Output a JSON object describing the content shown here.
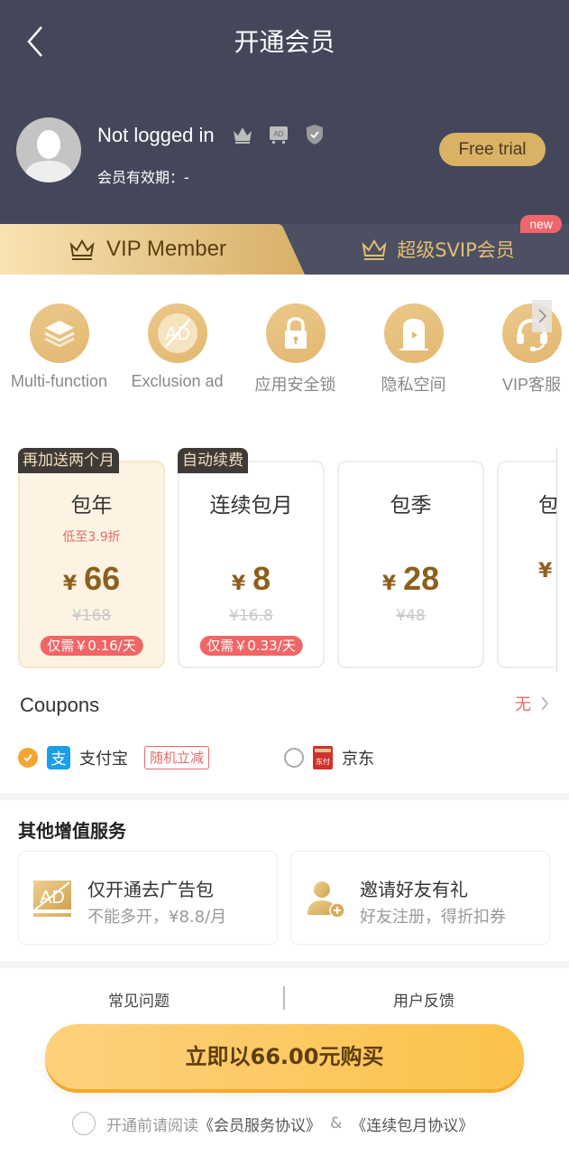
{
  "header": {
    "title": "开通会员",
    "back_icon": "chevron-left-icon"
  },
  "profile": {
    "username": "Not logged in",
    "status_icons": [
      "crown-icon",
      "ad-free-icon",
      "shield-check-icon"
    ],
    "expiry_label": "会员有效期：-",
    "free_trial_label": "Free trial"
  },
  "tabs": [
    {
      "label": "VIP Member",
      "icon": "crown-outline-icon",
      "active": true
    },
    {
      "label": "超级SVIP会员",
      "icon": "crown-outline-icon",
      "active": false,
      "badge": "new"
    }
  ],
  "features": [
    {
      "label": "Multi-function",
      "icon": "layers-icon"
    },
    {
      "label": "Exclusion ad",
      "icon": "no-ad-icon"
    },
    {
      "label": "应用安全锁",
      "icon": "lock-icon"
    },
    {
      "label": "隐私空间",
      "icon": "private-space-icon"
    },
    {
      "label": "VIP客服",
      "icon": "headset-icon"
    }
  ],
  "plans": [
    {
      "tag": "再加送两个月",
      "name": "包年",
      "discount": "低至3.9折",
      "currency": "¥",
      "price": "66",
      "original": "¥168",
      "per_day": "仅需￥0.16/天",
      "selected": true
    },
    {
      "tag": "自动续费",
      "name": "连续包月",
      "discount": "",
      "currency": "¥",
      "price": "8",
      "original": "¥16.8",
      "per_day": "仅需￥0.33/天",
      "selected": false
    },
    {
      "tag": "",
      "name": "包季",
      "discount": "",
      "currency": "¥",
      "price": "28",
      "original": "¥48",
      "per_day": "",
      "selected": false
    },
    {
      "tag": "",
      "name": "包",
      "discount": "",
      "currency": "¥",
      "price": "",
      "original": "",
      "per_day": "",
      "selected": false
    }
  ],
  "coupons": {
    "label": "Coupons",
    "value": "无"
  },
  "payments": [
    {
      "label": "支付宝",
      "icon": "alipay-icon",
      "selected": true,
      "promo": "随机立减"
    },
    {
      "label": "京东",
      "icon": "jd-pay-icon",
      "selected": false
    }
  ],
  "services": {
    "title": "其他增值服务",
    "items": [
      {
        "title": "仅开通去广告包",
        "subtitle": "不能多开，¥8.8/月",
        "icon": "no-ad-icon"
      },
      {
        "title": "邀请好友有礼",
        "subtitle": "好友注册，得折扣券",
        "icon": "invite-friend-icon"
      }
    ]
  },
  "footer": {
    "faq": "常见问题",
    "feedback": "用户反馈",
    "buy_label": "立即以66.00元购买",
    "agreement_prefix": "开通前请阅读",
    "agreement_doc1": "《会员服务协议》",
    "agreement_amp": "&",
    "agreement_doc2": "《连续包月协议》"
  },
  "colors": {
    "header_bg": "#444759",
    "gold": "#d9b266",
    "price_brown": "#8c5f1e",
    "accent_red": "#f06565",
    "buy_button": "#fbc24a"
  }
}
